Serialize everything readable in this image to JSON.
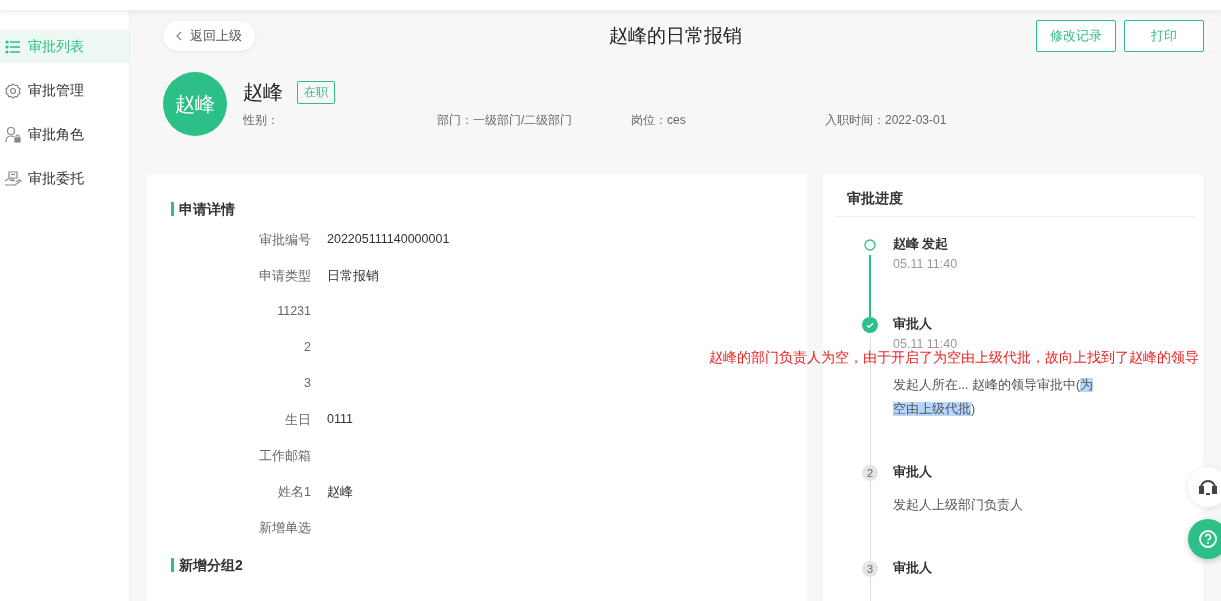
{
  "sidebar": {
    "items": [
      {
        "label": "审批列表",
        "selected": true
      },
      {
        "label": "审批管理",
        "selected": false
      },
      {
        "label": "审批角色",
        "selected": false
      },
      {
        "label": "审批委托",
        "selected": false
      }
    ]
  },
  "header": {
    "back": "返回上级",
    "title": "赵峰的日常报销",
    "buttons": [
      "修改记录",
      "打印"
    ]
  },
  "profile": {
    "avatar": "赵峰",
    "name": "赵峰",
    "status": "在职",
    "fields": [
      "性别：",
      "部门：一级部门/二级部门",
      "岗位：ces",
      "入职时间：2022-03-01"
    ]
  },
  "details": {
    "title": "申请详情",
    "rows": [
      {
        "label": "审批编号",
        "value": "202205111140000001"
      },
      {
        "label": "申请类型",
        "value": "日常报销"
      },
      {
        "label": "11231"
      },
      {
        "label": "2"
      },
      {
        "label": "3"
      },
      {
        "label": "生日",
        "value": "0111"
      },
      {
        "label": "工作邮箱"
      },
      {
        "label": "姓名1",
        "value": "赵峰"
      },
      {
        "label": "新增单选"
      }
    ],
    "next_section": "新增分组2"
  },
  "progress": {
    "title": "审批进度",
    "steps": [
      {
        "kind": "start",
        "title": "赵峰 发起",
        "time": "05.11 11:40"
      },
      {
        "kind": "done",
        "title": "审批人",
        "time": "05.11 11:40",
        "description": [
          {
            "text": "发起人所在...  赵峰的领导审批中(",
            "highlighted": false
          },
          {
            "text": "为空由上级代批",
            "highlighted": true
          },
          {
            "text": ")",
            "highlighted": false
          }
        ]
      },
      {
        "kind": "pending",
        "number": "2",
        "title": "审批人",
        "description": [
          {
            "text": "发起人上级部门负责人",
            "highlighted": false
          }
        ]
      },
      {
        "kind": "pending",
        "number": "3",
        "title": "审批人"
      }
    ]
  },
  "annotation": "赵峰的部门负责人为空，由于开启了为空由上级代批，故向上找到了赵峰的领导"
}
